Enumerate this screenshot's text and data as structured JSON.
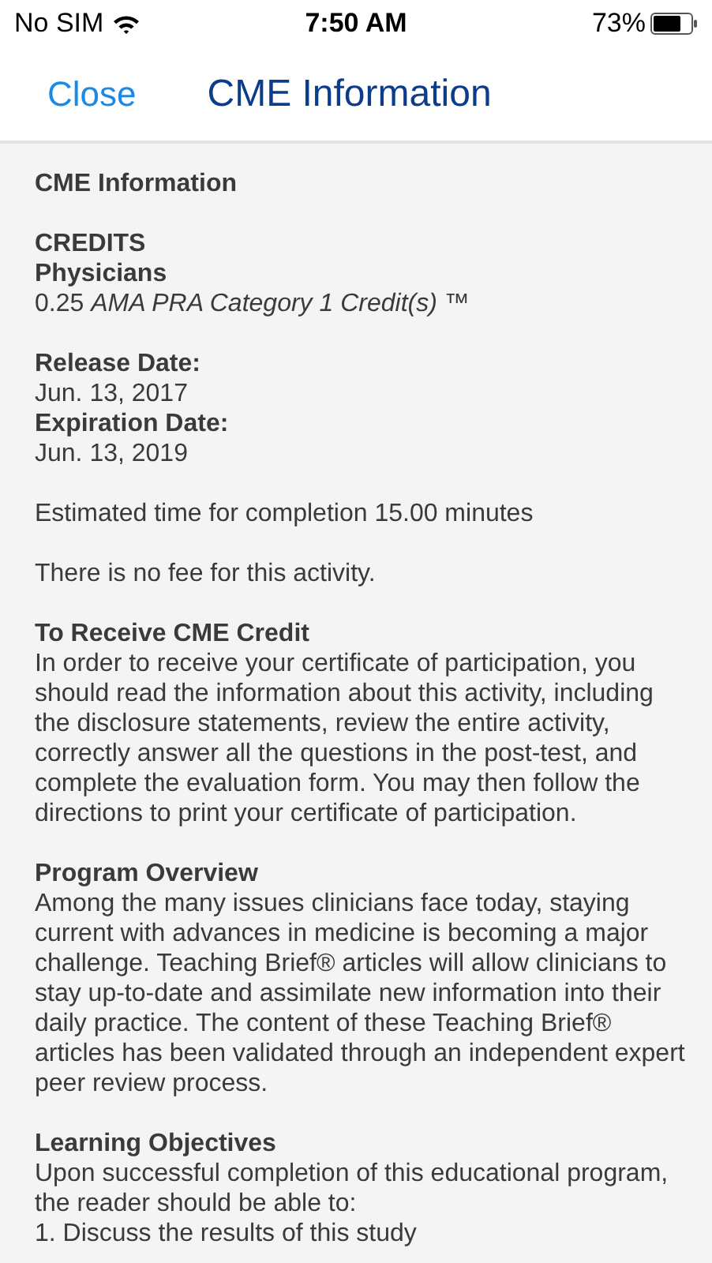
{
  "status_bar": {
    "carrier": "No SIM",
    "time": "7:50 AM",
    "battery": "73%"
  },
  "nav": {
    "close": "Close",
    "title": "CME Information"
  },
  "sections": [
    {
      "lines": [
        {
          "kind": "heading",
          "text": "CME Information"
        }
      ]
    },
    {
      "lines": [
        {
          "kind": "heading",
          "text": "CREDITS"
        },
        {
          "kind": "heading",
          "text": "Physicians"
        },
        {
          "kind": "text",
          "text": "0.25 *AMA PRA Category 1 Credit(s)* ™"
        }
      ]
    },
    {
      "lines": [
        {
          "kind": "heading",
          "text": "Release Date:"
        },
        {
          "kind": "text",
          "text": "Jun. 13, 2017"
        },
        {
          "kind": "heading",
          "text": "Expiration Date:"
        },
        {
          "kind": "text",
          "text": "Jun. 13, 2019"
        }
      ]
    },
    {
      "lines": [
        {
          "kind": "text",
          "text": "Estimated time for completion 15.00 minutes"
        }
      ]
    },
    {
      "lines": [
        {
          "kind": "text",
          "text": "There is no fee for this activity."
        }
      ]
    },
    {
      "lines": [
        {
          "kind": "heading",
          "text": "To Receive CME Credit"
        },
        {
          "kind": "text",
          "text": "In order to receive your certificate of participation, you should read the information about this activity, including the disclosure statements, review the entire activity, correctly answer all the questions in the post-test, and complete the evaluation form. You may then follow the directions to print your certificate of participation."
        }
      ]
    },
    {
      "lines": [
        {
          "kind": "heading",
          "text": "Program Overview"
        },
        {
          "kind": "text",
          "text": "Among the many issues clinicians face today, staying current with advances in medicine is becoming a major challenge. Teaching Brief® articles will allow clinicians to stay up-to-date and assimilate new information into their daily practice. The content of these Teaching Brief® articles has been validated through an independent expert peer review process."
        }
      ]
    },
    {
      "lines": [
        {
          "kind": "heading",
          "text": "Learning Objectives"
        },
        {
          "kind": "text",
          "text": "Upon successful completion of this educational program, the reader should be able to:"
        },
        {
          "kind": "text",
          "text": "1. Discuss the results of this study"
        }
      ]
    }
  ]
}
